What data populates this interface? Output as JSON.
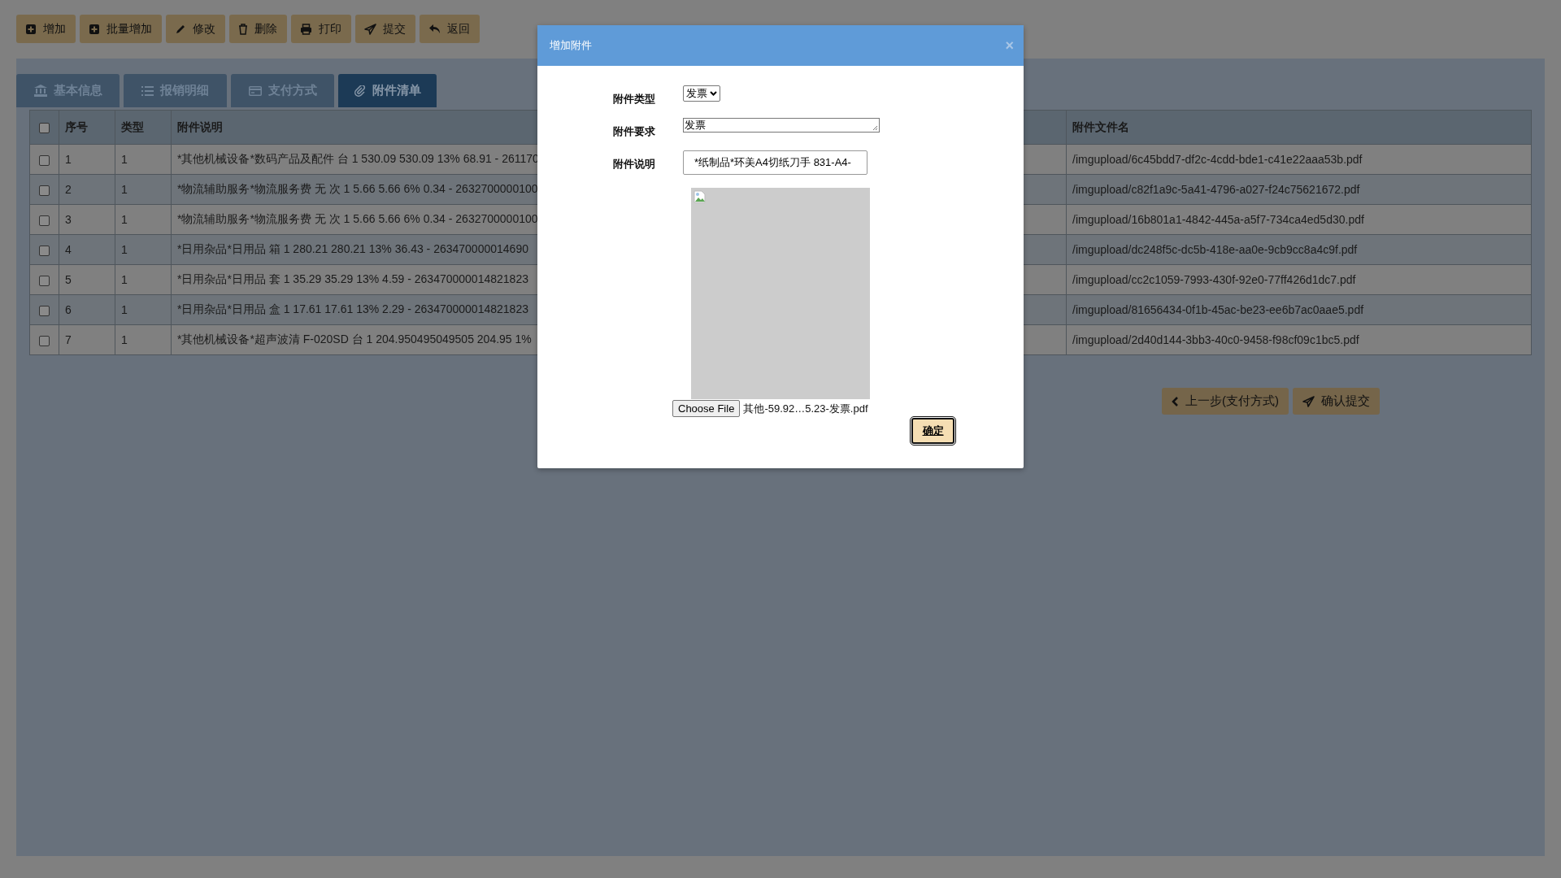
{
  "toolbar": [
    {
      "label": "增加"
    },
    {
      "label": "批量增加"
    },
    {
      "label": "修改"
    },
    {
      "label": "删除"
    },
    {
      "label": "打印"
    },
    {
      "label": "提交"
    },
    {
      "label": "返回"
    }
  ],
  "tabs": [
    {
      "label": "基本信息",
      "selected": false
    },
    {
      "label": "报销明细",
      "selected": false
    },
    {
      "label": "支付方式",
      "selected": false
    },
    {
      "label": "附件清单",
      "selected": true
    }
  ],
  "table": {
    "select_all": {
      "checked": false
    },
    "columns": [
      "序号",
      "类型",
      "附件说明",
      "附件文件名"
    ],
    "rows": [
      {
        "checked": false,
        "cells": [
          "1",
          "1",
          "*其他机械设备*数码产品及配件 台 1 530.09 530.09 13% 68.91 - 261170",
          "/imgupload/6c45bdd7-df2c-4cdd-bde1-c41e22aaa53b.pdf"
        ]
      },
      {
        "checked": false,
        "cells": [
          "2",
          "1",
          "*物流辅助服务*物流服务费 无 次 1 5.66 5.66 6% 0.34 - 2632700000100",
          "/imgupload/c82f1a9c-5a41-4796-a027-f24c75621672.pdf"
        ]
      },
      {
        "checked": false,
        "cells": [
          "3",
          "1",
          "*物流辅助服务*物流服务费 无 次 1 5.66 5.66 6% 0.34 - 2632700000100",
          "/imgupload/16b801a1-4842-445a-a5f7-734ca4ed5d30.pdf"
        ]
      },
      {
        "checked": false,
        "cells": [
          "4",
          "1",
          "*日用杂品*日用品 箱 1 280.21 280.21 13% 36.43 - 263470000014690",
          "/imgupload/dc248f5c-dc5b-418e-aa0e-9cb9cc8a4c9f.pdf"
        ]
      },
      {
        "checked": false,
        "cells": [
          "5",
          "1",
          "*日用杂品*日用品 套 1 35.29 35.29 13% 4.59 - 263470000014821823",
          "/imgupload/cc2c1059-7993-430f-92e0-77ff426d1dc7.pdf"
        ]
      },
      {
        "checked": false,
        "cells": [
          "6",
          "1",
          "*日用杂品*日用品 盒 1 17.61 17.61 13% 2.29 - 263470000014821823",
          "/imgupload/81656434-0f1b-45ac-be23-ee6b7ac0aae5.pdf"
        ]
      },
      {
        "checked": false,
        "cells": [
          "7",
          "1",
          "*其他机械设备*超声波清 F-020SD 台 1 204.950495049505 204.95 1%",
          "/imgupload/2d40d144-3bb3-40c0-9458-f98cf09c1bc5.pdf"
        ]
      }
    ]
  },
  "nav_buttons": [
    {
      "label": "上一步(支付方式)"
    },
    {
      "label": "确认提交"
    }
  ],
  "dialog": {
    "title": "增加附件",
    "close": "×",
    "fields": [
      {
        "kind": "select",
        "label": "附件类型",
        "value": "发票"
      },
      {
        "kind": "textarea",
        "label": "附件要求",
        "value": "发票"
      },
      {
        "kind": "input",
        "label": "附件说明",
        "value": "*纸制品*环美A4切纸刀手 831-A4-"
      }
    ],
    "file": {
      "button": "Choose File",
      "name": "其他-59.92…5.23-发票.pdf"
    },
    "confirm": "确定"
  }
}
